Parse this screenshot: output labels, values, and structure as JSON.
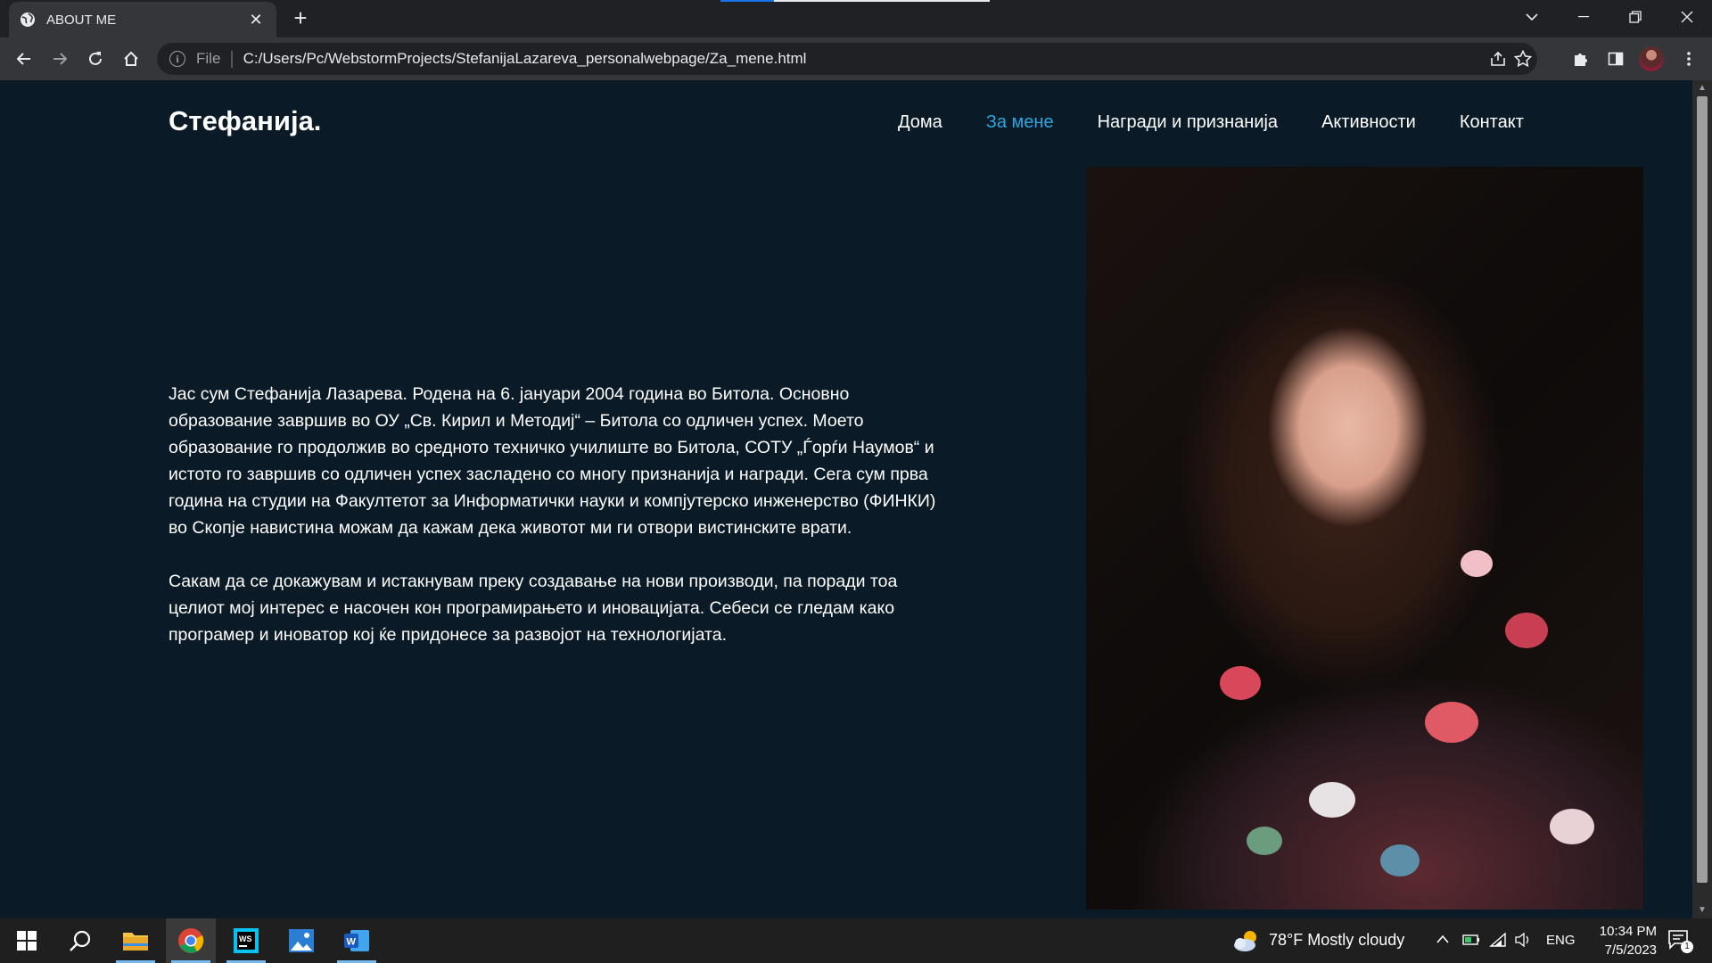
{
  "browser": {
    "tab_title": "ABOUT ME",
    "tab_close": "✕",
    "new_tab": "+",
    "omnibox": {
      "scheme_label": "File",
      "url": "C:/Users/Pc/WebstormProjects/StefanijaLazareva_personalwebpage/Za_mene.html"
    }
  },
  "site": {
    "brand": "Стефанија.",
    "nav": [
      {
        "label": "Дома",
        "active": false
      },
      {
        "label": "За мене",
        "active": true
      },
      {
        "label": "Награди и признанија",
        "active": false
      },
      {
        "label": "Активности",
        "active": false
      },
      {
        "label": "Контакт",
        "active": false
      }
    ],
    "paragraphs": [
      "Јас сум Стефанија Лазарева. Родена на 6. јануари 2004 година во Битола. Основно образование завршив во ОУ „Св. Кирил и Методиј“ – Битола со одличен успех. Моето образование го продолжив во средното техничко училиште во Битола, СОТУ „Ѓорѓи Наумов“ и истото го завршив со одличен успех засладено со многу признанија и награди. Сега сум прва година на студии на Факултетот за Информатички науки и компјутерско инженерство (ФИНКИ) во Скопје навистина можам да кажам дека животот ми ги отвори вистинските врати.",
      "Сакам да се докажувам и истакнувам преку создавање на нови производи, па поради тоа целиот мој интерес е насочен кон програмирањето и иновацијата. Себеси се гледам како програмер и иноватор кој ќе придонесе за развојот на технологијата."
    ],
    "colors": {
      "background": "#0a1a27",
      "accent": "#2aa6e0",
      "text": "#ffffff"
    }
  },
  "taskbar": {
    "weather": "78°F  Mostly cloudy",
    "language": "ENG",
    "time": "10:34 PM",
    "date": "7/5/2023",
    "notification_count": "1"
  }
}
